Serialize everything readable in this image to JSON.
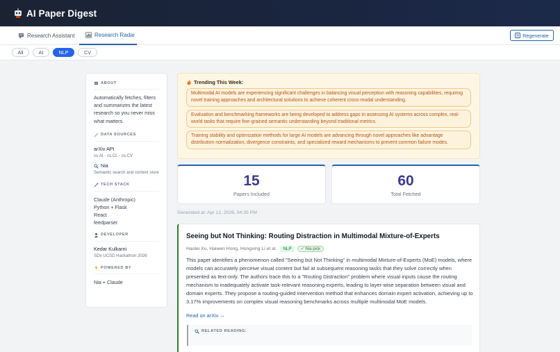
{
  "app": {
    "title": "AI Paper Digest",
    "logo_icon": "robot-icon"
  },
  "nav": {
    "tabs": [
      {
        "label": "Research Assistant",
        "icon": "chat-icon",
        "active": false
      },
      {
        "label": "Research Radar",
        "icon": "chart-icon",
        "active": true
      }
    ],
    "regenerate_label": "Regenerate"
  },
  "filters": [
    "All",
    "AI",
    "NLP",
    "CV"
  ],
  "active_filter": "NLP",
  "sidebar": {
    "about": {
      "heading": "ABOUT",
      "text": "Automatically fetches, filters and summarizes the latest research so you never miss what matters."
    },
    "data_sources": {
      "heading": "DATA SOURCES",
      "items": [
        {
          "name": "arXiv API",
          "sub": "cs.AI · cs.CL · cs.CV"
        },
        {
          "name": "Nia",
          "sub": "Semantic search and context store"
        }
      ]
    },
    "tech_stack": {
      "heading": "TECH STACK",
      "items": [
        "Claude (Anthropic)",
        "Python + Flask",
        "React",
        "feedparser"
      ]
    },
    "developer": {
      "heading": "DEVELOPER",
      "name": "Kedar Kulkarni",
      "sub": "SDx UCSD Hackathon 2026"
    },
    "powered_by": {
      "heading": "POWERED BY",
      "text": "Nia + Claude"
    }
  },
  "trending": {
    "heading": "Trending This Week:",
    "items": [
      "Multimodal AI models are experiencing significant challenges in balancing visual perception with reasoning capabilities, requiring novel training approaches and architectural solutions to achieve coherent cross-modal understanding.",
      "Evaluation and benchmarking frameworks are being developed to address gaps in assessing AI systems across complex, real-world tasks that require fine-grained semantic understanding beyond traditional metrics.",
      "Training stability and optimization methods for large AI models are advancing through novel approaches like advantage distribution normalization, divergence constraints, and specialized reward mechanisms to prevent common failure modes."
    ]
  },
  "stats": {
    "papers_included": {
      "value": "15",
      "label": "Papers Included"
    },
    "total_fetched": {
      "value": "60",
      "label": "Total Fetched"
    }
  },
  "generated_at": "Generated at: Apr 12, 2026, 04:35 PM",
  "paper": {
    "title": "Seeing but Not Thinking: Routing Distraction in Multimodal Mixture-of-Experts",
    "authors": "Haolei Xu, Haiwen Hong, Hongxing Li et al.",
    "tag": "NLP",
    "pick": "✓ Nia pick",
    "abstract": "This paper identifies a phenomenon called \"Seeing but Not Thinking\" in multimodal Mixture-of-Experts (MoE) models, where models can accurately perceive visual content but fail at subsequent reasoning tasks that they solve correctly when presented as text-only. The authors trace this to a \"Routing Distraction\" problem where visual inputs cause the routing mechanism to inadequately activate task-relevant reasoning experts, leading to layer-wise separation between visual and domain experts. They propose a routing-guided intervention method that enhances domain expert activation, achieving up to 3.17% improvements on complex visual reasoning benchmarks across multiple multimodal MoE models.",
    "link": "Read on arXiv →",
    "related_heading": "RELATED READING:"
  },
  "colors": {
    "accent": "#2563a8",
    "header_bg": "#1b2333",
    "active_pill": "#2563eb",
    "trend_text": "#b2561c",
    "paper_border": "#2f7d32",
    "stat_number": "#3b3a8f"
  }
}
